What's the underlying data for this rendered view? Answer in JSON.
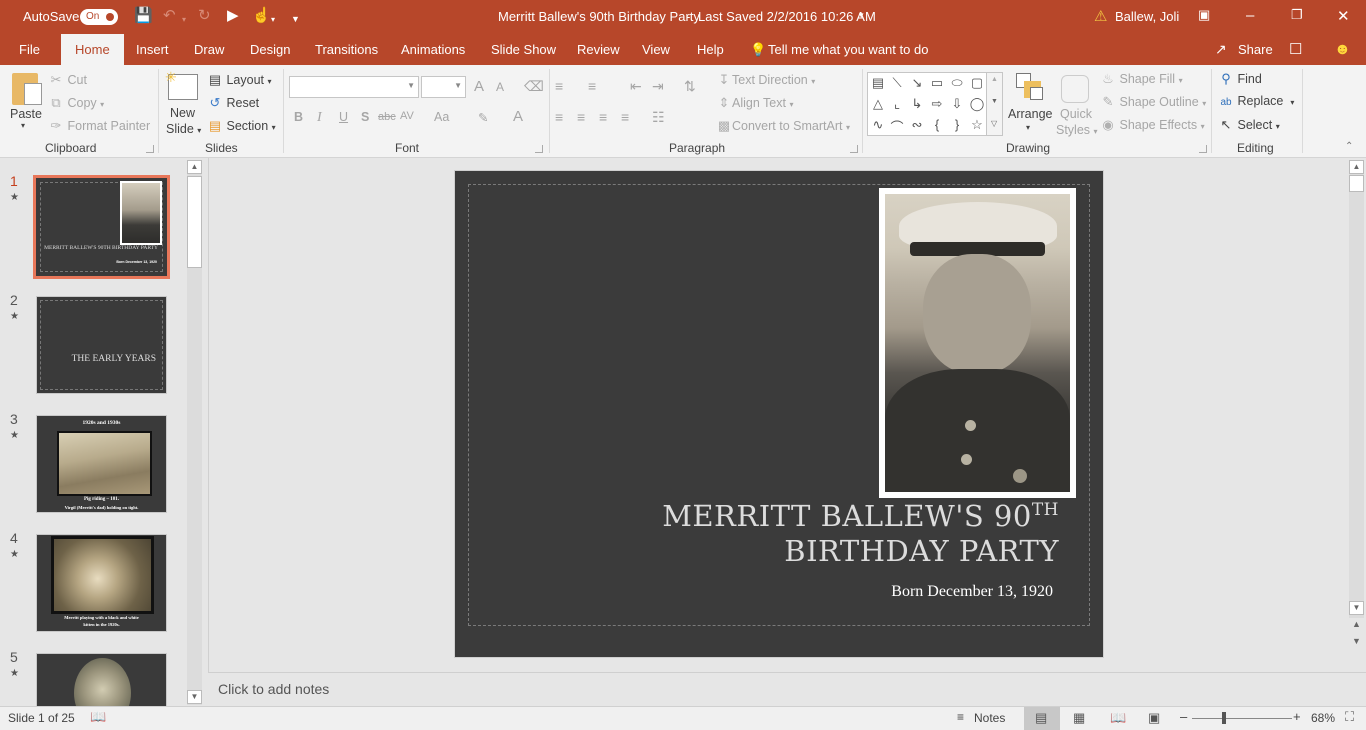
{
  "titlebar": {
    "autosave_label": "AutoSave",
    "autosave_state": "On",
    "document_title": "Merritt Ballew's 90th Birthday Party",
    "separator": "-",
    "last_saved": "Last Saved 2/2/2016 10:26 AM",
    "user_name": "Ballew, Joli",
    "qat_icons": [
      "save-sync-icon",
      "undo-icon",
      "redo-icon",
      "present-from-beginning-icon",
      "touch-mode-icon",
      "customize-qat-icon"
    ]
  },
  "tabs": [
    "File",
    "Home",
    "Insert",
    "Draw",
    "Design",
    "Transitions",
    "Animations",
    "Slide Show",
    "Review",
    "View",
    "Help"
  ],
  "active_tab": "Home",
  "tell_me": "Tell me what you want to do",
  "share_label": "Share",
  "ribbon": {
    "clipboard": {
      "label": "Clipboard",
      "paste": "Paste",
      "cut": "Cut",
      "copy": "Copy",
      "format_painter": "Format Painter"
    },
    "slides": {
      "label": "Slides",
      "new_slide_1": "New",
      "new_slide_2": "Slide",
      "layout": "Layout",
      "reset": "Reset",
      "section": "Section"
    },
    "font": {
      "label": "Font",
      "font_name": "",
      "font_size": "",
      "bold": "B",
      "italic": "I",
      "underline": "U",
      "shadow": "S",
      "strike": "abc",
      "spacing": "AV",
      "case": "Aa",
      "color": "A",
      "grow": "A",
      "shrink": "A"
    },
    "paragraph": {
      "label": "Paragraph",
      "text_direction": "Text Direction",
      "align_text": "Align Text",
      "convert_smartart": "Convert to SmartArt"
    },
    "drawing": {
      "label": "Drawing",
      "arrange": "Arrange",
      "quick_styles_1": "Quick",
      "quick_styles_2": "Styles",
      "shape_fill": "Shape Fill",
      "shape_outline": "Shape Outline",
      "shape_effects": "Shape Effects"
    },
    "editing": {
      "label": "Editing",
      "find": "Find",
      "replace": "Replace",
      "select": "Select"
    }
  },
  "thumbnails": [
    {
      "num": "1",
      "title": "MERRITT BALLEW'S 90TH BIRTHDAY PARTY",
      "sub": "Born December 13, 1920",
      "selected": true
    },
    {
      "num": "2",
      "title": "THE EARLY YEARS"
    },
    {
      "num": "3",
      "title": "1920s and 1930s",
      "caption1": "Pig riding – 101.",
      "caption2": "Virgil (Merritt's dad) holding on tight."
    },
    {
      "num": "4",
      "caption1": "Merritt playing with a black and white",
      "caption2": "kitten in the 1920s."
    },
    {
      "num": "5"
    }
  ],
  "slide": {
    "title_pre": "MERRITT BALLEW'S 90",
    "title_sup": "TH",
    "title_post": " BIRTHDAY PARTY",
    "subtitle": "Born December 13, 1920",
    "photo": "portrait-photo-marine-uniform"
  },
  "notes_placeholder": "Click to add notes",
  "status": {
    "slide_count": "Slide 1 of 25",
    "notes": "Notes",
    "zoom": "68%",
    "zoom_value_percent": 68
  },
  "colors": {
    "accent": "#b7472a",
    "selection": "#e8775a",
    "slide_bg": "#3b3b3b"
  }
}
